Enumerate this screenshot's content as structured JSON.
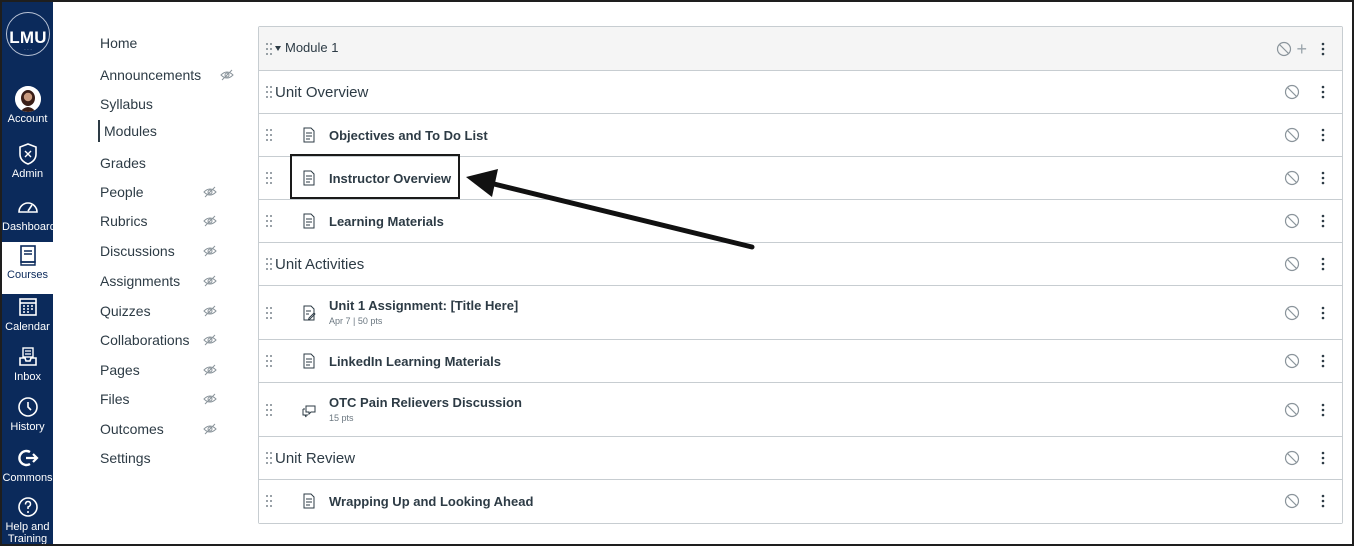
{
  "global_nav": {
    "logo_text": "LMU",
    "items": [
      {
        "label": "Account",
        "icon": "avatar"
      },
      {
        "label": "Admin",
        "icon": "admin-icon"
      },
      {
        "label": "Dashboard",
        "icon": "dashboard-icon"
      },
      {
        "label": "Courses",
        "icon": "courses-icon"
      },
      {
        "label": "Calendar",
        "icon": "calendar-icon"
      },
      {
        "label": "Inbox",
        "icon": "inbox-icon"
      },
      {
        "label": "History",
        "icon": "history-icon"
      },
      {
        "label": "Commons",
        "icon": "commons-icon"
      },
      {
        "label": "Help and Training",
        "icon": "help-icon"
      }
    ],
    "active": "Courses",
    "colors": {
      "background": "#0b2a5b",
      "active_bg": "#ffffff"
    }
  },
  "course_nav": {
    "items": [
      {
        "label": "Home",
        "hidden": false
      },
      {
        "label": "Announcements",
        "hidden": true
      },
      {
        "label": "Syllabus",
        "hidden": false
      },
      {
        "label": "Modules",
        "hidden": false
      },
      {
        "label": "Grades",
        "hidden": false
      },
      {
        "label": "People",
        "hidden": true
      },
      {
        "label": "Rubrics",
        "hidden": true
      },
      {
        "label": "Discussions",
        "hidden": true
      },
      {
        "label": "Assignments",
        "hidden": true
      },
      {
        "label": "Quizzes",
        "hidden": true
      },
      {
        "label": "Collaborations",
        "hidden": true
      },
      {
        "label": "Pages",
        "hidden": true
      },
      {
        "label": "Files",
        "hidden": true
      },
      {
        "label": "Outcomes",
        "hidden": true
      },
      {
        "label": "Settings",
        "hidden": false
      }
    ],
    "active": "Modules"
  },
  "module": {
    "title": "Module 1",
    "plus": "+",
    "rows": [
      {
        "type": "header",
        "title": "Unit Overview"
      },
      {
        "type": "page",
        "title": "Objectives and To Do List"
      },
      {
        "type": "page",
        "title": "Instructor Overview",
        "highlighted": true
      },
      {
        "type": "page",
        "title": "Learning Materials"
      },
      {
        "type": "header",
        "title": "Unit Activities"
      },
      {
        "type": "assignment",
        "title": "Unit 1 Assignment: [Title Here]",
        "meta": "Apr 7  |  50 pts"
      },
      {
        "type": "page",
        "title": "LinkedIn Learning Materials"
      },
      {
        "type": "discussion",
        "title": "OTC Pain Relievers Discussion",
        "meta": "15 pts"
      },
      {
        "type": "header",
        "title": "Unit Review"
      },
      {
        "type": "page",
        "title": "Wrapping Up and Looking Ahead"
      }
    ]
  }
}
